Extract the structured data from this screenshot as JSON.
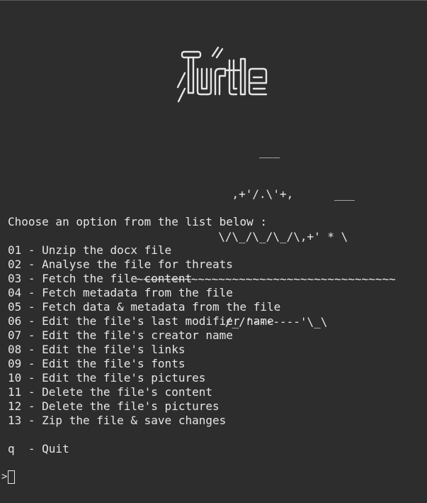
{
  "logo": {
    "label": "Turtle",
    "icon": "turtle-logo-icon",
    "ascii_art": [
      "                                      ___",
      "                                  ,+'/.\\'+,      ___",
      "                                \\/\\_/\\_/\\_/\\,+' * \\",
      "                    ~~~~~~~~~~~~~~~~~~~~~~~~~~~~~~~~~~~~~~",
      "                                 /_/'-------'\\_\\"
    ]
  },
  "prompt_heading": "Choose an option from the list below :",
  "menu": [
    {
      "text": "01 - Unzip the docx file"
    },
    {
      "text": "02 - Analyse the file for threats"
    },
    {
      "text": "03 - Fetch the file content"
    },
    {
      "text": "04 - Fetch metadata from the file"
    },
    {
      "text": "05 - Fetch data & metadata from the file"
    },
    {
      "text": "06 - Edit the file's last modifier name"
    },
    {
      "text": "07 - Edit the file's creator name"
    },
    {
      "text": "08 - Edit the file's links"
    },
    {
      "text": "09 - Edit the file's fonts"
    },
    {
      "text": "10 - Edit the file's pictures"
    },
    {
      "text": "11 - Delete the file's content"
    },
    {
      "text": "12 - Delete the file's pictures"
    },
    {
      "text": "13 - Zip the file & save changes"
    }
  ],
  "quit_option": "q  - Quit",
  "input": {
    "prompt_symbol": ">",
    "value": ""
  },
  "colors": {
    "background": "#2d2d2d",
    "foreground": "#e6e6e6"
  }
}
